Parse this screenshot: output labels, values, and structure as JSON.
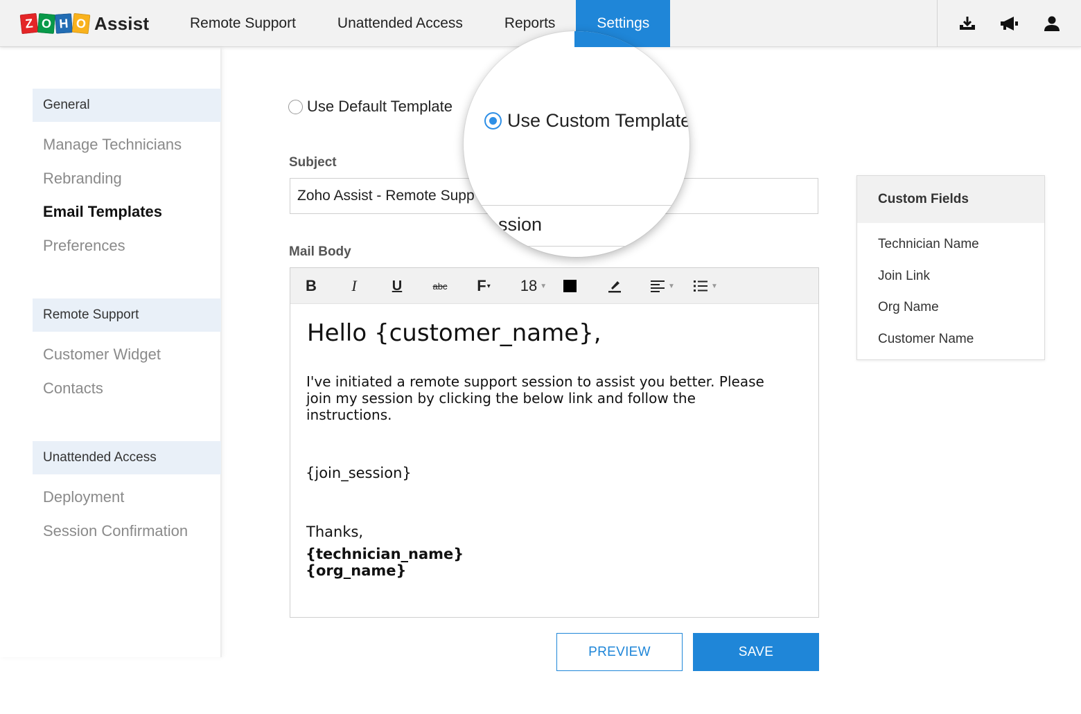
{
  "app": {
    "logo_letters": [
      "Z",
      "O",
      "H",
      "O"
    ],
    "logo_colors": [
      "#e42527",
      "#089949",
      "#226db4",
      "#f9b21d"
    ],
    "name": "Assist"
  },
  "nav": {
    "items": [
      "Remote Support",
      "Unattended Access",
      "Reports",
      "Settings"
    ],
    "active": "Settings"
  },
  "top_icons": [
    "download-icon",
    "megaphone-icon",
    "user-icon"
  ],
  "sidebar": {
    "sections": [
      {
        "header": "General",
        "items": [
          "Manage Technicians",
          "Rebranding",
          "Email Templates",
          "Preferences"
        ]
      },
      {
        "header": "Remote Support",
        "items": [
          "Customer Widget",
          "Contacts"
        ]
      },
      {
        "header": "Unattended Access",
        "items": [
          "Deployment",
          "Session Confirmation"
        ]
      }
    ],
    "active_item": "Email Templates"
  },
  "template": {
    "default_label": "Use Default Template",
    "custom_label": "Use Custom Template",
    "selected": "custom"
  },
  "subject": {
    "label": "Subject",
    "value": "Zoho Assist - Remote Supp",
    "magnified_fragment": "ssion"
  },
  "mail_body": {
    "label": "Mail Body",
    "toolbar": {
      "bold": "B",
      "italic": "I",
      "underline": "U",
      "strike": "abc",
      "font": "F",
      "font_size": "18",
      "text_color": "#000000"
    },
    "greeting": "Hello {customer_name},",
    "paragraph_lines": [
      "I've initiated a remote support session to assist you better. Please",
      "join my session by clicking the below link and follow the",
      "instructions."
    ],
    "join_placeholder": "{join_session}",
    "closing": "Thanks,",
    "signature": [
      "{technician_name}",
      "{org_name}"
    ]
  },
  "buttons": {
    "preview": "PREVIEW",
    "save": "SAVE"
  },
  "custom_fields": {
    "title": "Custom Fields",
    "items": [
      "Technician Name",
      "Join Link",
      "Org Name",
      "Customer Name"
    ]
  },
  "colors": {
    "accent": "#1f86d8"
  }
}
